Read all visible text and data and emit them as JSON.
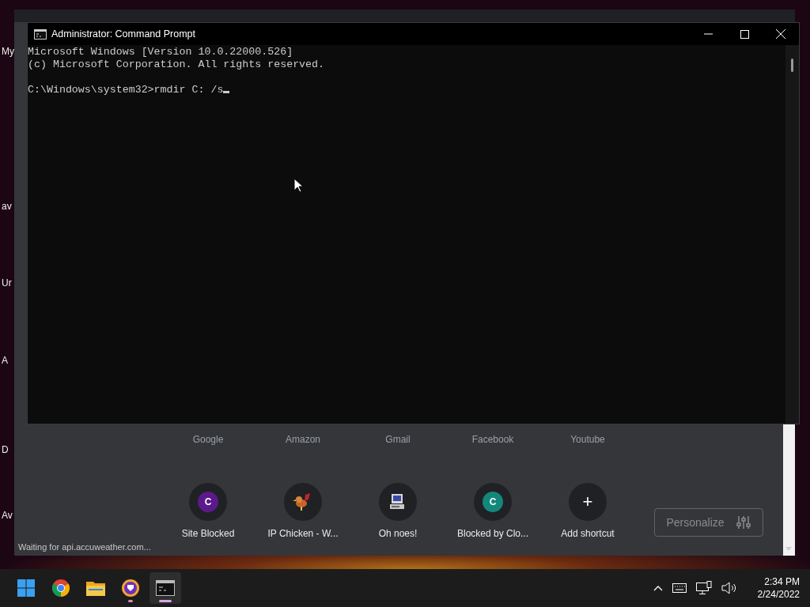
{
  "desktop": {
    "icon_labels": [
      "My",
      "av",
      "Ur",
      "A",
      "D",
      "Av"
    ]
  },
  "browser": {
    "top_sites": [
      "Google",
      "Amazon",
      "Gmail",
      "Facebook",
      "Youtube"
    ],
    "shortcuts": [
      {
        "label": "Site Blocked",
        "kind": "letter",
        "letter": "C",
        "color": "#5b1a8c"
      },
      {
        "label": "IP Chicken - W...",
        "kind": "chicken"
      },
      {
        "label": "Oh noes!",
        "kind": "computer"
      },
      {
        "label": "Blocked by Clo...",
        "kind": "letter",
        "letter": "C",
        "color": "#13877a"
      },
      {
        "label": "Add shortcut",
        "kind": "add",
        "symbol": "+"
      }
    ],
    "personalize_button": "Personalize",
    "status": "Waiting for api.accuweather.com..."
  },
  "cmd": {
    "title": "Administrator: Command Prompt",
    "output": [
      "Microsoft Windows [Version 10.0.22000.526]",
      "(c) Microsoft Corporation. All rights reserved."
    ],
    "prompt": "C:\\Windows\\system32>rmdir C: /s"
  },
  "taskbar": {
    "apps": [
      {
        "kind": "start",
        "running": false,
        "focused": false
      },
      {
        "kind": "chrome",
        "running": false,
        "focused": false
      },
      {
        "kind": "explorer",
        "running": false,
        "focused": false
      },
      {
        "kind": "brave",
        "running": true,
        "focused": false
      },
      {
        "kind": "terminal",
        "running": true,
        "focused": true
      }
    ],
    "time": "2:34 PM",
    "date": "2/24/2022"
  }
}
